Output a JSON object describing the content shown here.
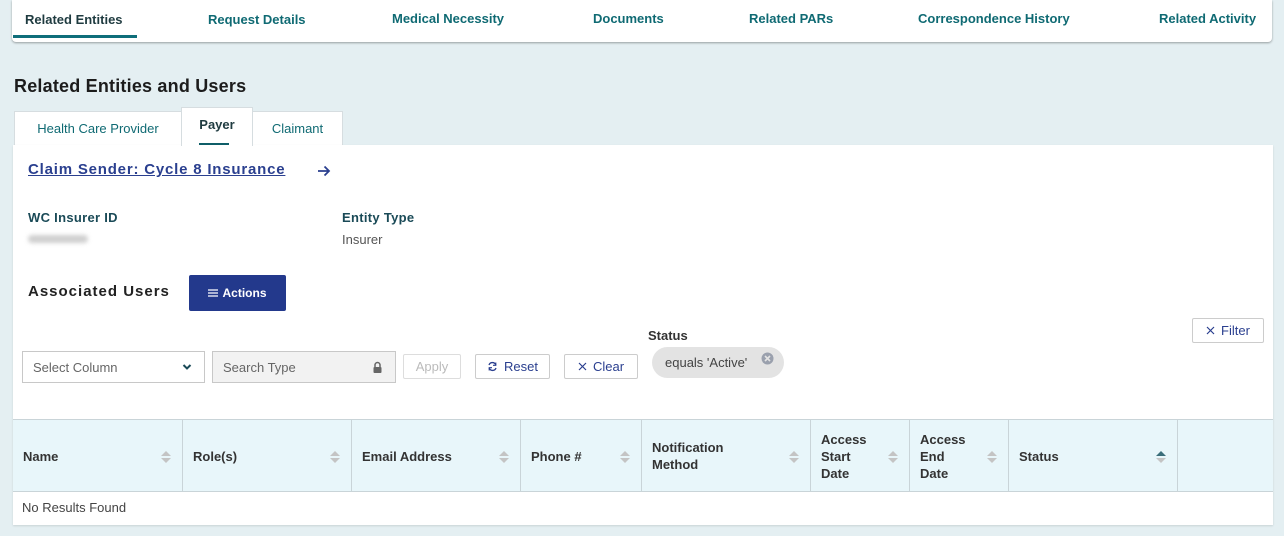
{
  "topnav": {
    "tabs": [
      {
        "label": "Related Entities",
        "active": true
      },
      {
        "label": "Request Details"
      },
      {
        "label": "Medical Necessity"
      },
      {
        "label": "Documents"
      },
      {
        "label": "Related PARs"
      },
      {
        "label": "Correspondence History"
      },
      {
        "label": "Related Activity"
      }
    ]
  },
  "section_title": "Related Entities and Users",
  "subtabs": [
    {
      "label": "Health Care Provider"
    },
    {
      "label": "Payer",
      "active": true
    },
    {
      "label": "Claimant"
    }
  ],
  "entity": {
    "claim_link": "Claim Sender: Cycle 8 Insurance ",
    "fields": [
      {
        "label": "WC Insurer ID",
        "value": "(redacted)"
      },
      {
        "label": "Entity Type",
        "value": "Insurer"
      }
    ]
  },
  "associated_users": {
    "title": "Associated Users",
    "actions_label": "Actions",
    "filters": {
      "select_column_placeholder": "Select Column",
      "search_type_placeholder": "Search Type",
      "apply_label": "Apply",
      "reset_label": "Reset",
      "clear_label": "Clear",
      "filter_label": "Filter",
      "status_label": "Status",
      "status_chip": "equals 'Active'"
    },
    "table": {
      "columns": [
        {
          "label": "Name",
          "sort": "none"
        },
        {
          "label": "Role(s)",
          "sort": "none"
        },
        {
          "label": "Email Address",
          "sort": "none"
        },
        {
          "label": "Phone #",
          "sort": "none"
        },
        {
          "label": "Notification Method",
          "sort": "none"
        },
        {
          "label": "Access Start Date",
          "sort": "none"
        },
        {
          "label": "Access End Date",
          "sort": "none"
        },
        {
          "label": "Status",
          "sort": "asc"
        },
        {
          "label": "",
          "sort": null
        }
      ],
      "rows": [],
      "empty_message": "No Results Found"
    }
  },
  "colors": {
    "accent_teal": "#0f6e7a",
    "primary_blue": "#23398c",
    "link_blue": "#2a3f8f",
    "background": "#e4eff2",
    "table_header_bg": "#e8f6fa"
  }
}
